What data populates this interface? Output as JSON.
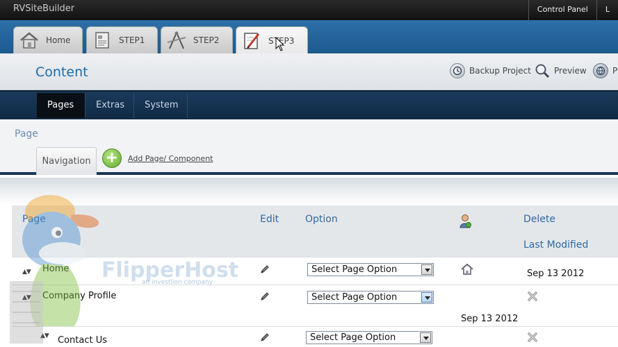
{
  "app": {
    "brand": "RVSiteBuilder",
    "top_links": [
      "Control Panel",
      "L"
    ]
  },
  "steps": [
    {
      "label": "Home",
      "icon": "house-icon"
    },
    {
      "label": "STEP1",
      "icon": "document-form-icon"
    },
    {
      "label": "STEP2",
      "icon": "drafting-tools-icon"
    },
    {
      "label": "STEP3",
      "icon": "edit-pencil-icon",
      "active": true
    }
  ],
  "content_header": {
    "title": "Content",
    "actions": [
      {
        "label": "Backup Project",
        "icon": "backup-clock-icon"
      },
      {
        "label": "Preview",
        "icon": "magnifier-icon"
      },
      {
        "label": "P",
        "icon": "publish-globe-icon"
      }
    ]
  },
  "subnav": {
    "tabs": [
      "Pages",
      "Extras",
      "System"
    ],
    "active": "Pages"
  },
  "page_section": {
    "label": "Page",
    "tab": "Navigation",
    "add_link": "Add Page/ Component"
  },
  "table": {
    "headers": {
      "page": "Page",
      "edit": "Edit",
      "option": "Option",
      "delete": "Delete",
      "last_modified": "Last Modified"
    },
    "rows": [
      {
        "name": "Home",
        "option": "Select Page Option",
        "action_icon": "home-icon",
        "modified": "Sep 13 2012"
      },
      {
        "name": "Company Profile",
        "option": "Select Page Option",
        "action_icon": "delete-x-icon",
        "modified": "Sep 13 2012"
      },
      {
        "name": "Contact Us",
        "option": "Select Page Option",
        "action_icon": "delete-x-icon",
        "modified": ""
      }
    ]
  },
  "watermark": {
    "brand": "FlipperHost",
    "tagline": "an investlion company",
    "cap_text": "FLIPPER HOST"
  },
  "colors": {
    "accent_blue": "#1d6aa6",
    "nav_dark": "#102a44",
    "add_green": "#5da82b"
  }
}
